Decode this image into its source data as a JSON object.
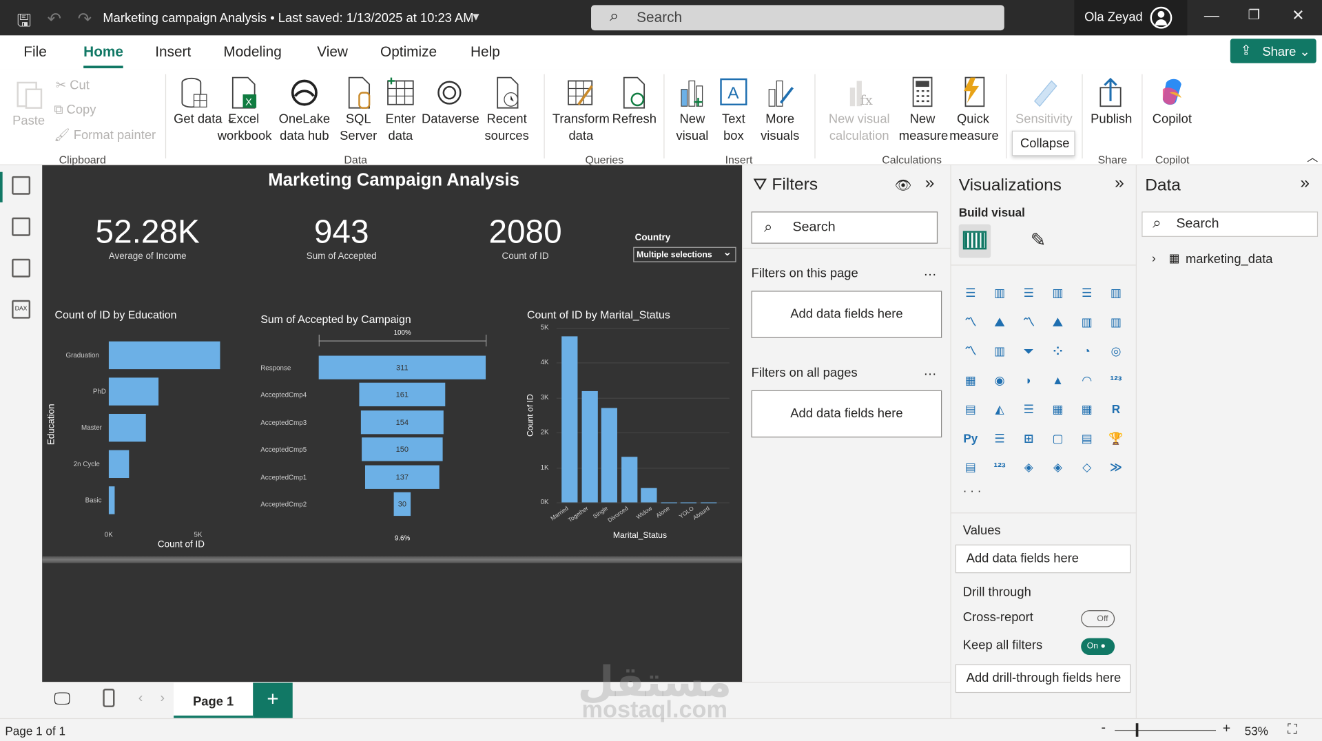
{
  "titlebar": {
    "title": "Marketing campaign Analysis  •  Last saved: 1/13/2025 at 10:23 AM",
    "search_placeholder": "Search",
    "user": "Ola Zeyad"
  },
  "menu": {
    "items": [
      "File",
      "Home",
      "Insert",
      "Modeling",
      "View",
      "Optimize",
      "Help"
    ],
    "active": "Home",
    "share": "Share"
  },
  "ribbon": {
    "clipboard": {
      "paste": "Paste",
      "cut": "Cut",
      "copy": "Copy",
      "format_painter": "Format painter",
      "group": "Clipboard"
    },
    "data": {
      "get_data": "Get data",
      "excel": "Excel workbook",
      "onelake": "OneLake data hub",
      "sql": "SQL Server",
      "enter": "Enter data",
      "dataverse": "Dataverse",
      "recent": "Recent sources",
      "group": "Data"
    },
    "queries": {
      "transform": "Transform data",
      "refresh": "Refresh",
      "group": "Queries"
    },
    "insert": {
      "new_visual": "New visual",
      "text_box": "Text box",
      "more_visuals": "More visuals",
      "group": "Insert"
    },
    "calculations": {
      "new_visual_calc": "New visual calculation",
      "new_measure": "New measure",
      "quick_measure": "Quick measure",
      "group": "Calculations"
    },
    "sensitivity": {
      "label": "Sensitivity",
      "group": "Sensitivity",
      "tooltip": "Collapse"
    },
    "share": {
      "publish": "Publish",
      "group": "Share"
    },
    "copilot": {
      "label": "Copilot",
      "group": "Copilot"
    }
  },
  "report": {
    "title": "Marketing Campaign Analysis",
    "kpis": [
      {
        "value": "52.28K",
        "label": "Average of  Income"
      },
      {
        "value": "943",
        "label": "Sum of Accepted"
      },
      {
        "value": "2080",
        "label": "Count of ID"
      }
    ],
    "slicer": {
      "label": "Country",
      "value": "Multiple selections"
    }
  },
  "chart_data": [
    {
      "type": "bar",
      "title": "Count of ID by Education",
      "categories": [
        "Graduation",
        "PhD",
        "Master",
        "2n Cycle",
        "Basic"
      ],
      "values": [
        1027,
        460,
        344,
        184,
        54
      ],
      "xlabel": "Count of ID",
      "ylabel": "Education",
      "xticks": [
        "0K",
        "5K"
      ]
    },
    {
      "type": "funnel",
      "title": "Sum of Accepted by Campaign",
      "categories": [
        "Response",
        "AcceptedCmp4",
        "AcceptedCmp3",
        "AcceptedCmp5",
        "AcceptedCmp1",
        "AcceptedCmp2"
      ],
      "values": [
        311,
        161,
        154,
        150,
        137,
        30
      ],
      "top_label": "100%",
      "bottom_label": "9.6%"
    },
    {
      "type": "bar",
      "title": "Count of ID by Marital_Status",
      "categories": [
        "Married",
        "Together",
        "Single",
        "Divorced",
        "Widow",
        "Alone",
        "YOLO",
        "Absurd"
      ],
      "values": [
        4750,
        3200,
        2700,
        1300,
        420,
        10,
        5,
        5
      ],
      "xlabel": "Marital_Status",
      "ylabel": "Count of ID",
      "yticks": [
        "0K",
        "1K",
        "2K",
        "3K",
        "4K",
        "5K"
      ],
      "ylim": [
        0,
        5000
      ]
    }
  ],
  "filters": {
    "title": "Filters",
    "search": "Search",
    "page_section": "Filters on this page",
    "all_section": "Filters on all pages",
    "add": "Add data fields here"
  },
  "viz": {
    "title": "Visualizations",
    "build": "Build visual",
    "values": "Values",
    "values_add": "Add data fields here",
    "drill": "Drill through",
    "cross": "Cross-report",
    "cross_state": "Off",
    "keep": "Keep all filters",
    "keep_state": "On",
    "drill_add": "Add drill-through fields here"
  },
  "data_pane": {
    "title": "Data",
    "search": "Search",
    "table": "marketing_data"
  },
  "pages": {
    "tab": "Page 1",
    "status": "Page 1 of 1",
    "zoom": "53%"
  },
  "watermark": {
    "arabic": "مستقل",
    "latin": "mostaql.com"
  }
}
